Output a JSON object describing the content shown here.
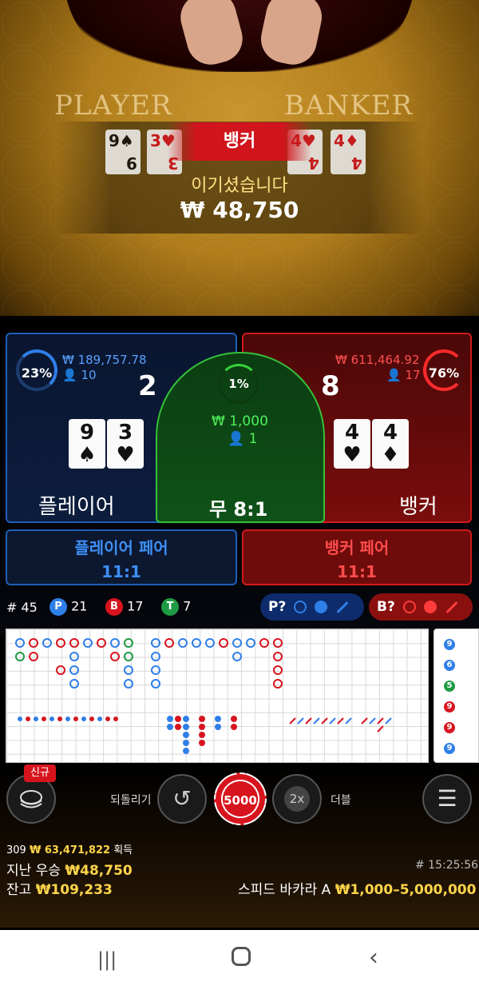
{
  "table": {
    "player_label": "PLAYER",
    "banker_label": "BANKER"
  },
  "result": {
    "winner": "뱅커",
    "message": "이기셨습니다",
    "amount": "₩ 48,750",
    "player_cards": [
      {
        "rank": "9",
        "suit": "♠"
      },
      {
        "rank": "3",
        "suit": "♥"
      }
    ],
    "banker_cards": [
      {
        "rank": "4",
        "suit": "♥"
      },
      {
        "rank": "4",
        "suit": "♦"
      }
    ]
  },
  "player": {
    "percent": "23%",
    "total_bet": "₩ 189,757.78",
    "bettors": "10",
    "score": "2",
    "label": "플레이어",
    "card1_rank": "9",
    "card1_suit": "♠",
    "card2_rank": "3",
    "card2_suit": "♥"
  },
  "tie": {
    "percent": "1%",
    "total_bet": "₩ 1,000",
    "bettors": "1",
    "label": "무 8:1"
  },
  "banker": {
    "percent": "76%",
    "total_bet": "₩ 611,464.92",
    "bettors": "17",
    "score": "8",
    "label": "뱅커",
    "card1_rank": "4",
    "card1_suit": "♥",
    "card2_rank": "4",
    "card2_suit": "♦"
  },
  "side_bets": {
    "player_pair_label": "플레이어 페어",
    "player_pair_odds": "11:1",
    "banker_pair_label": "뱅커 페어",
    "banker_pair_odds": "11:1"
  },
  "stats": {
    "round_prefix": "#",
    "round": "45",
    "p_letter": "P",
    "p_count": "21",
    "b_letter": "B",
    "b_count": "17",
    "t_letter": "T",
    "t_count": "7",
    "p_predict": "P?",
    "b_predict": "B?"
  },
  "controls": {
    "new_badge": "신규",
    "undo_label": "되돌리기",
    "chip_value": "5000",
    "double_icon_text": "2x",
    "double_label": "더블"
  },
  "footer": {
    "winners_count": "309",
    "winners_amount": "₩ 63,471,822",
    "winners_suffix": "획득",
    "last_win_label": "지난 우승",
    "last_win_amount": "₩48,750",
    "balance_label": "잔고",
    "balance_amount": "₩109,233",
    "time": "# 15:25:56",
    "table_name": "스피드 바카라 A",
    "limits": "₩1,000–5,000,000"
  },
  "colors": {
    "player_blue": "#2f7fe8",
    "banker_red": "#d7141e",
    "tie_green": "#36c13a",
    "gold": "#ffd54a"
  }
}
